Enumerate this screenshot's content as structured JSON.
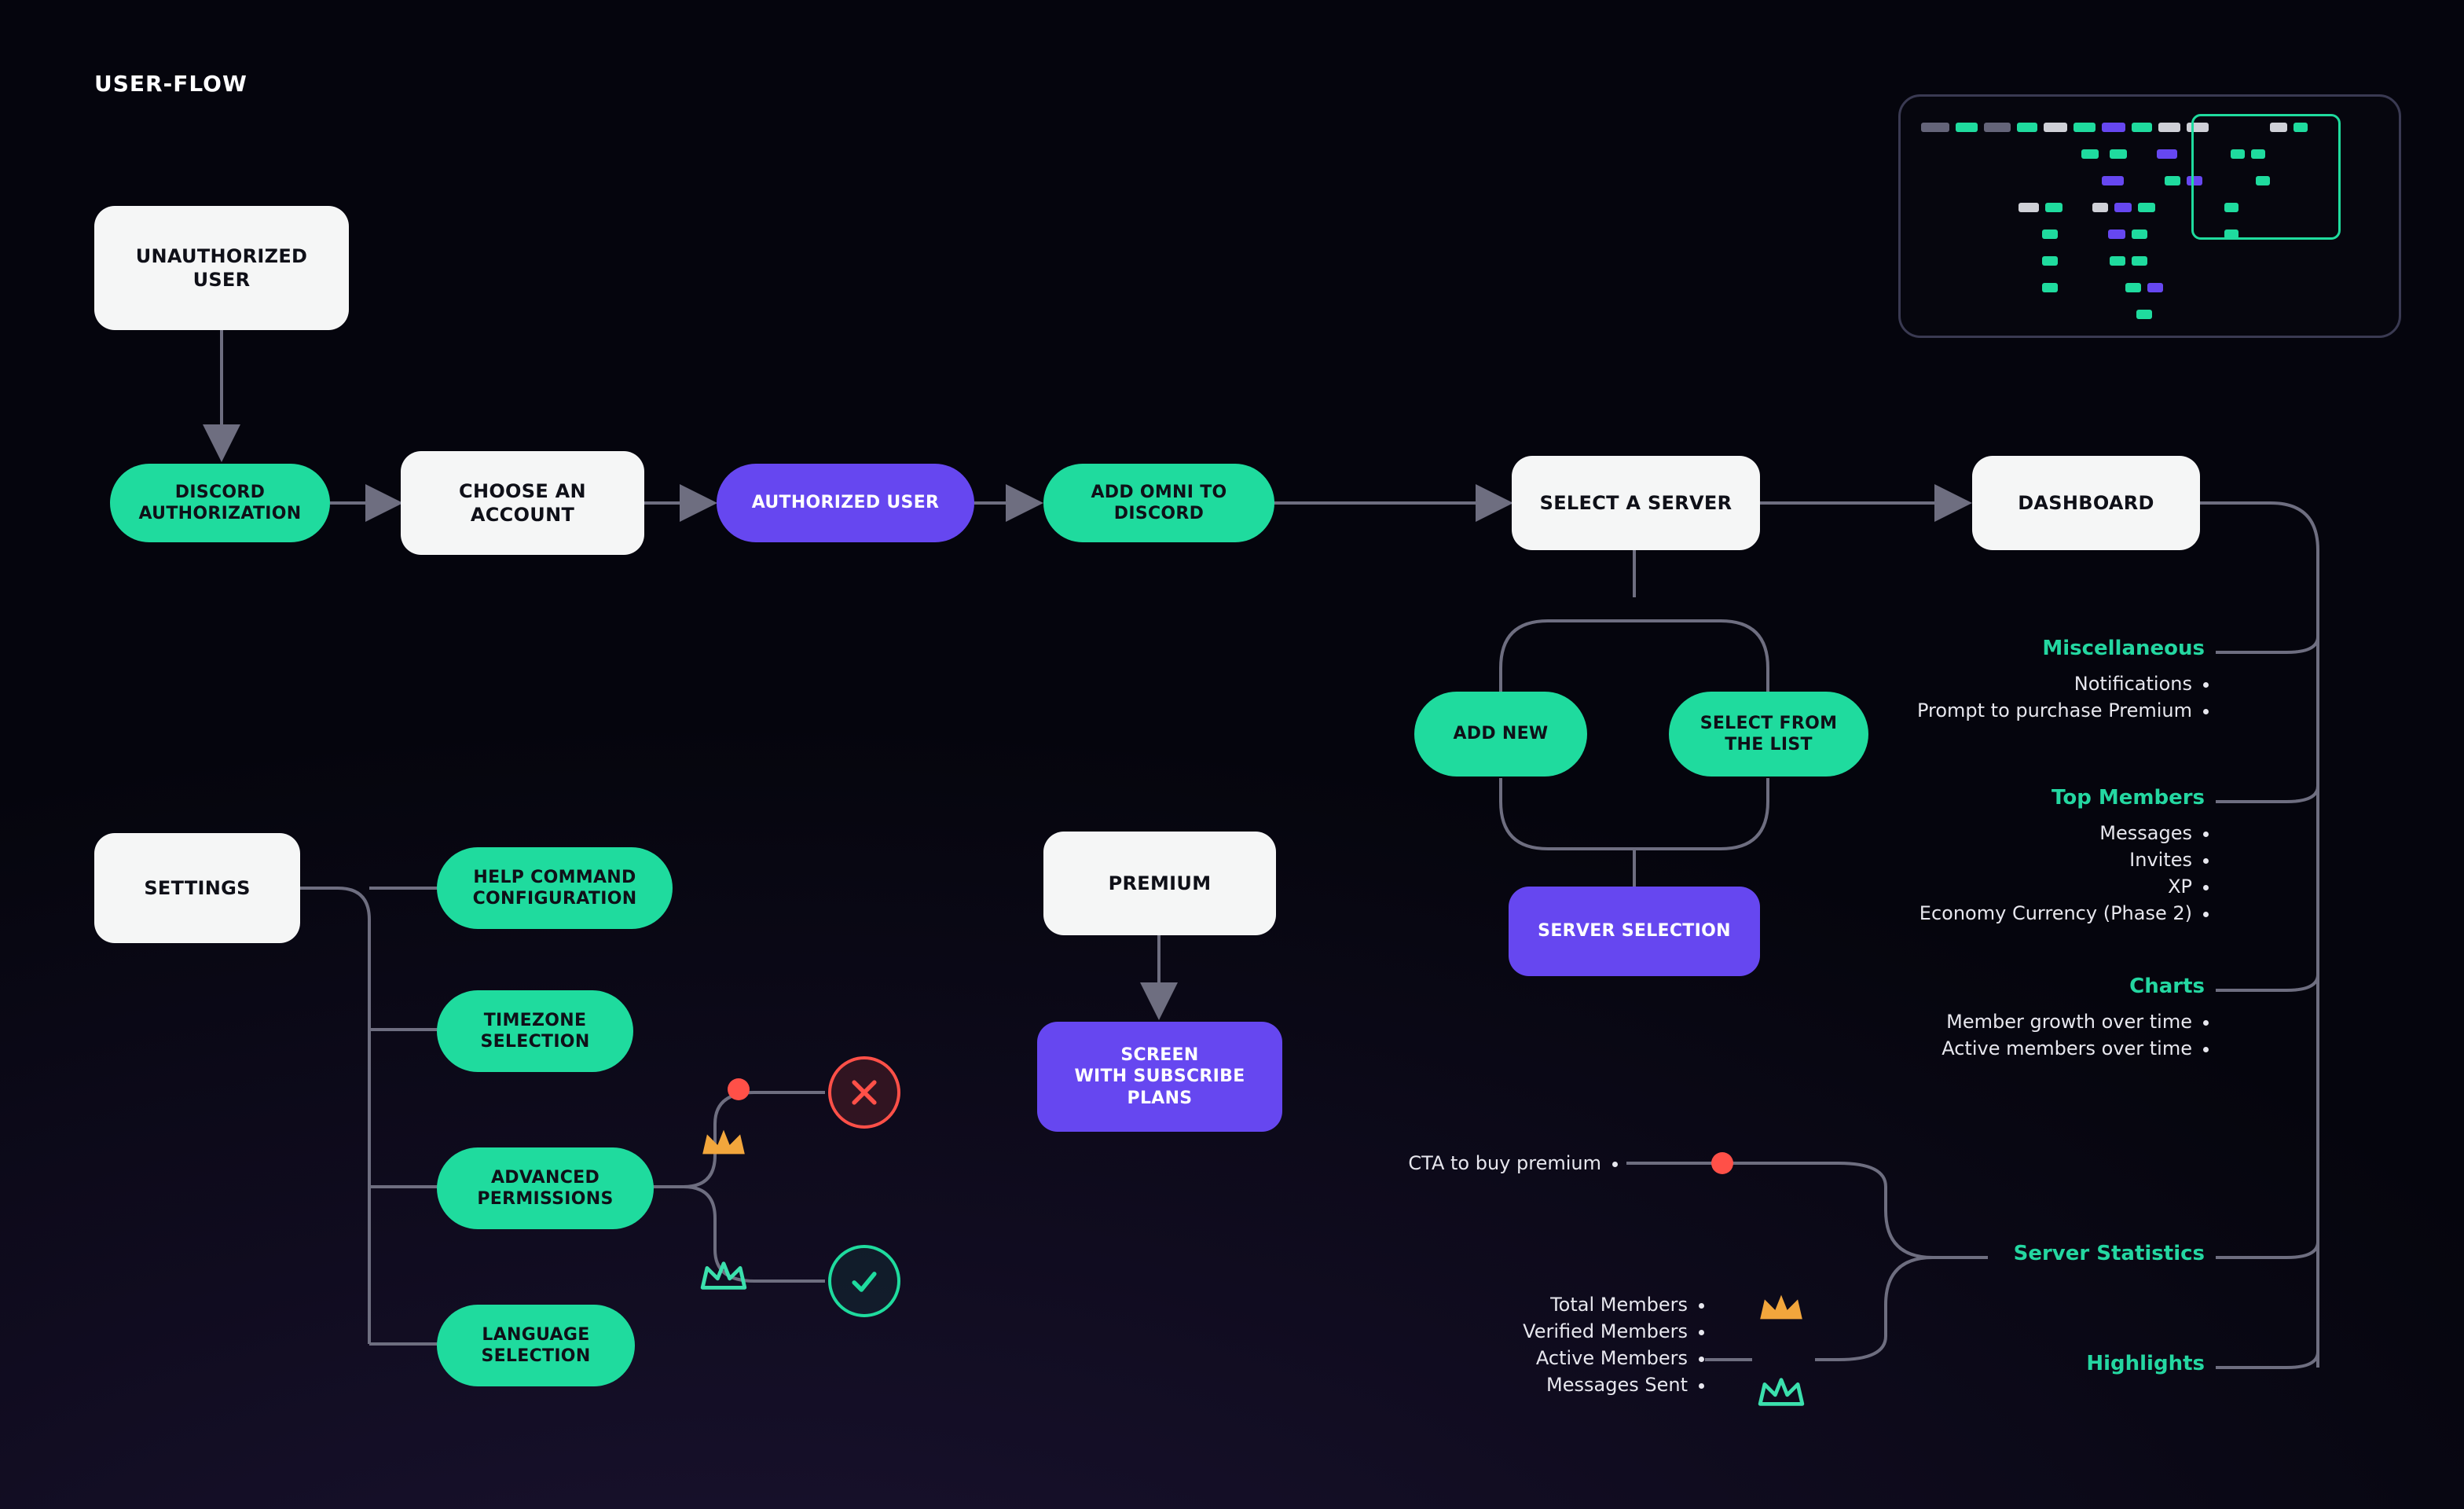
{
  "title": "USER-FLOW",
  "nodes": {
    "unauthorized_user": "UNAUTHORIZED USER",
    "discord_auth": "DISCORD\nAUTHORIZATION",
    "choose_account": "CHOOSE AN\nACCOUNT",
    "authorized_user": "AUTHORIZED USER",
    "add_omni": "ADD OMNI TO\nDISCORD",
    "select_server": "SELECT A SERVER",
    "dashboard": "DASHBOARD",
    "add_new": "ADD NEW",
    "select_from_list": "SELECT FROM\nTHE LIST",
    "server_selection": "SERVER SELECTION",
    "settings": "SETTINGS",
    "help_cmd": "HELP COMMAND\nCONFIGURATION",
    "timezone": "TIMEZONE\nSELECTION",
    "adv_perm": "ADVANCED\nPERMISSIONS",
    "language": "LANGUAGE\nSELECTION",
    "premium": "PREMIUM",
    "subscribe_plans": "SCREEN\nWITH SUBSCRIBE\nPLANS"
  },
  "sections": {
    "miscellaneous": {
      "title": "Miscellaneous",
      "items": [
        "Notifications",
        "Prompt to purchase Premium"
      ]
    },
    "top_members": {
      "title": "Top Members",
      "items": [
        "Messages",
        "Invites",
        "XP",
        "Economy Currency (Phase 2)"
      ]
    },
    "charts": {
      "title": "Charts",
      "items": [
        "Member growth over time",
        "Active members over time"
      ]
    },
    "server_statistics": {
      "title": "Server Statistics",
      "cta": "CTA to buy premium",
      "items": [
        "Total Members",
        "Verified Members",
        "Active Members",
        "Messages Sent"
      ]
    },
    "highlights": {
      "title": "Highlights"
    }
  },
  "icons": {
    "reject": "cross",
    "accept": "check",
    "crown_gold": "premium-crown-gold",
    "crown_green": "premium-crown-green"
  }
}
